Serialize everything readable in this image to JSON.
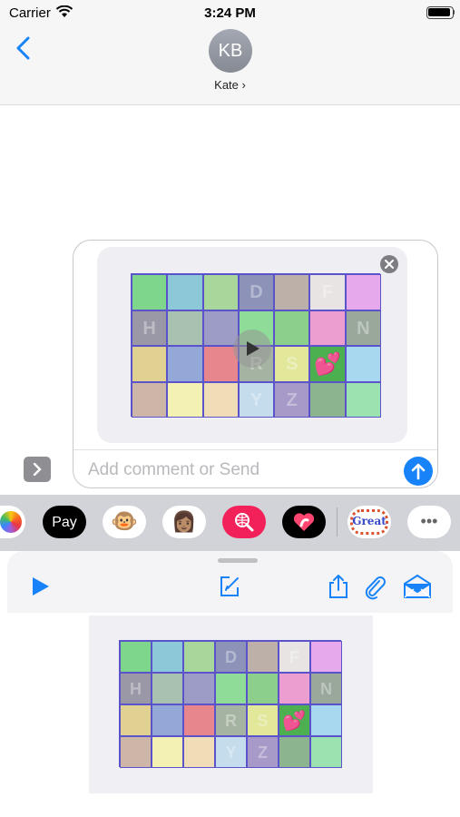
{
  "status_bar": {
    "carrier": "Carrier",
    "time": "3:24 PM"
  },
  "header": {
    "avatar_initials": "KB",
    "contact_name": "Kate ›"
  },
  "compose": {
    "placeholder": "Add comment or Send"
  },
  "grid": {
    "rows": 4,
    "cols": 7,
    "letters": [
      [
        "",
        "",
        "",
        "D",
        "",
        "F",
        ""
      ],
      [
        "H",
        "",
        "",
        "",
        "",
        "",
        "N"
      ],
      [
        "",
        "",
        "",
        "R",
        "S",
        "",
        ""
      ],
      [
        "",
        "",
        "",
        "Y",
        "Z",
        "",
        ""
      ]
    ],
    "cells": [
      [
        "#7ed58c",
        "#8cc8d8",
        "#a9d79b",
        "#8d93b8",
        "#bcb0a8",
        "#e8e4e4",
        "#e6a9ec"
      ],
      [
        "#9a98a7",
        "#a9c2b0",
        "#9d9cc6",
        "#8fdc98",
        "#8bcf8a",
        "#ec9ed0",
        "#9aa89b"
      ],
      [
        "#e0d092",
        "#93a8d6",
        "#e8868e",
        "#a5b4a2",
        "#e2e79a",
        "#4caf50",
        "#a8d8f0"
      ],
      [
        "#cdb6a8",
        "#f4f2b2",
        "#f0dcb6",
        "#c4dcec",
        "#a89ac8",
        "#8cb58f",
        "#9ae2b0"
      ]
    ],
    "sticker": "💕",
    "sticker_row": 2,
    "sticker_col": 5
  },
  "app_strip": {
    "apps": [
      {
        "name": "photos-app-icon",
        "bg": "#ffffff",
        "label": ""
      },
      {
        "name": "apple-pay-app-icon",
        "bg": "#000000",
        "label": "Pay"
      },
      {
        "name": "monkey-memoji-app-icon",
        "bg": "#ffffff",
        "label": "🐵"
      },
      {
        "name": "memoji-app-icon",
        "bg": "#ffffff",
        "label": "👩🏽"
      },
      {
        "name": "image-search-app-icon",
        "bg": "#f2215a",
        "label": ""
      },
      {
        "name": "digital-touch-app-icon",
        "bg": "#000000",
        "label": ""
      },
      {
        "name": "sticker-app-icon",
        "bg": "#ffffff",
        "label": "Great"
      },
      {
        "name": "more-apps-icon",
        "bg": "#ffffff",
        "label": "•••"
      }
    ]
  },
  "colors": {
    "accent": "#1883f9",
    "grid_border": "#5b53c9"
  }
}
